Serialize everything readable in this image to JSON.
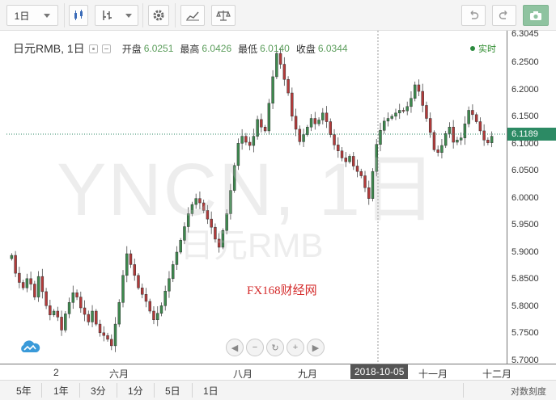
{
  "toolbar": {
    "interval": "1日",
    "icons": [
      "candlestick-icon",
      "indicator-icon",
      "gear-icon",
      "compare-icon",
      "scale-icon",
      "undo-icon",
      "redo-icon",
      "camera-icon"
    ]
  },
  "legend": {
    "symbol": "日元RMB, 1日",
    "open_label": "开盘",
    "open": "6.0251",
    "high_label": "最高",
    "high": "6.0426",
    "low_label": "最低",
    "low": "6.0140",
    "close_label": "收盘",
    "close": "6.0344"
  },
  "status": {
    "live": "实时"
  },
  "watermark": {
    "main": "YNCN, 1日",
    "sub": "日元RMB"
  },
  "source": "FX168财经网",
  "price_axis": {
    "top_partial": "6.3045",
    "labels": [
      "6.2500",
      "6.2000",
      "6.1500",
      "6.1000",
      "6.0500",
      "6.0000",
      "5.9500",
      "5.9000",
      "5.8500",
      "5.8000",
      "5.7500",
      "5.7000"
    ],
    "current": "6.1189",
    "current_color": "#2c8a64"
  },
  "time_axis": {
    "labels": [
      "2",
      "六月",
      "八月",
      "九月",
      "十一月",
      "十二月"
    ],
    "crosshair": "2018-10-05"
  },
  "range_bar": {
    "items": [
      "5年",
      "1年",
      "3分",
      "1分",
      "5日",
      "1日"
    ],
    "scale": "对数刻度"
  },
  "colors": {
    "up": "#3d8a4e",
    "down": "#b33a3a",
    "line": "#2c8a64"
  },
  "chart_data": {
    "type": "candlestick",
    "title": "日元RMB, 1日",
    "xlabel": "",
    "ylabel": "",
    "ylim": [
      5.695,
      6.31
    ],
    "grid": false,
    "current_price": 6.1189,
    "close": [
      5.895,
      5.862,
      5.845,
      5.835,
      5.852,
      5.842,
      5.818,
      5.856,
      5.828,
      5.802,
      5.785,
      5.792,
      5.781,
      5.757,
      5.787,
      5.808,
      5.826,
      5.818,
      5.798,
      5.786,
      5.772,
      5.792,
      5.768,
      5.752,
      5.747,
      5.74,
      5.728,
      5.768,
      5.808,
      5.858,
      5.898,
      5.878,
      5.858,
      5.835,
      5.823,
      5.81,
      5.792,
      5.776,
      5.788,
      5.802,
      5.829,
      5.852,
      5.878,
      5.901,
      5.923,
      5.948,
      5.972,
      5.989,
      6.0,
      5.992,
      5.978,
      5.962,
      5.947,
      5.925,
      5.91,
      5.941,
      5.972,
      6.015,
      6.061,
      6.102,
      6.115,
      6.104,
      6.098,
      6.115,
      6.146,
      6.132,
      6.125,
      6.176,
      6.225,
      6.268,
      6.248,
      6.22,
      6.195,
      6.152,
      6.128,
      6.105,
      6.118,
      6.132,
      6.148,
      6.138,
      6.145,
      6.158,
      6.142,
      6.118,
      6.099,
      6.088,
      6.075,
      6.068,
      6.078,
      6.06,
      6.05,
      6.042,
      6.02,
      6.0,
      6.05,
      6.1,
      6.126,
      6.143,
      6.148,
      6.152,
      6.158,
      6.163,
      6.162,
      6.17,
      6.185,
      6.21,
      6.198,
      6.172,
      6.148,
      6.122,
      6.09,
      6.085,
      6.098,
      6.12,
      6.132,
      6.104,
      6.108,
      6.112,
      6.138,
      6.163,
      6.155,
      6.142,
      6.125,
      6.108,
      6.103,
      6.115
    ]
  }
}
